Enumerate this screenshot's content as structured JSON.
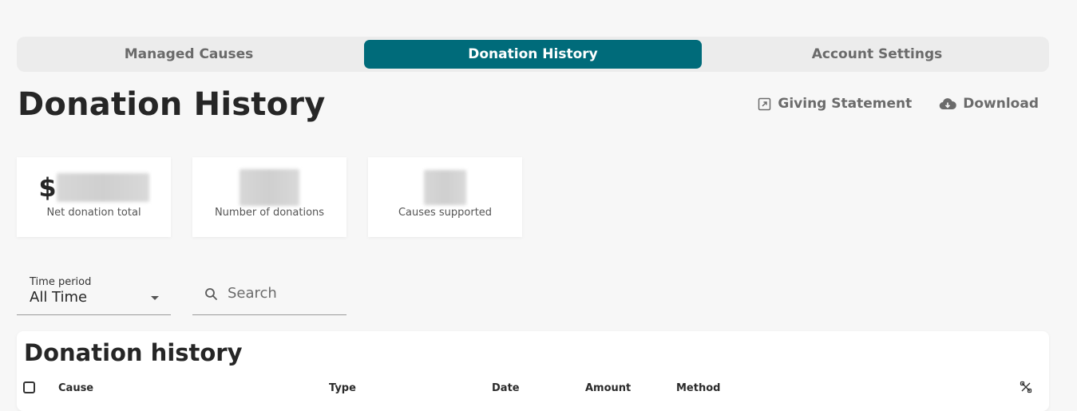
{
  "tabs": [
    {
      "label": "Managed Causes",
      "active": false
    },
    {
      "label": "Donation History",
      "active": true
    },
    {
      "label": "Account Settings",
      "active": false
    }
  ],
  "header": {
    "title": "Donation History",
    "actions": {
      "statement_label": "Giving Statement",
      "download_label": "Download"
    }
  },
  "stats": {
    "total": {
      "prefix": "$",
      "label": "Net donation total"
    },
    "count": {
      "label": "Number of donations"
    },
    "causes": {
      "label": "Causes supported"
    }
  },
  "filters": {
    "time_period": {
      "label": "Time period",
      "value": "All Time"
    },
    "search": {
      "placeholder": "Search"
    }
  },
  "table": {
    "title": "Donation history",
    "columns": [
      "Cause",
      "Type",
      "Date",
      "Amount",
      "Method"
    ]
  },
  "colors": {
    "accent": "#006b7a",
    "background": "#f7f7f7"
  }
}
